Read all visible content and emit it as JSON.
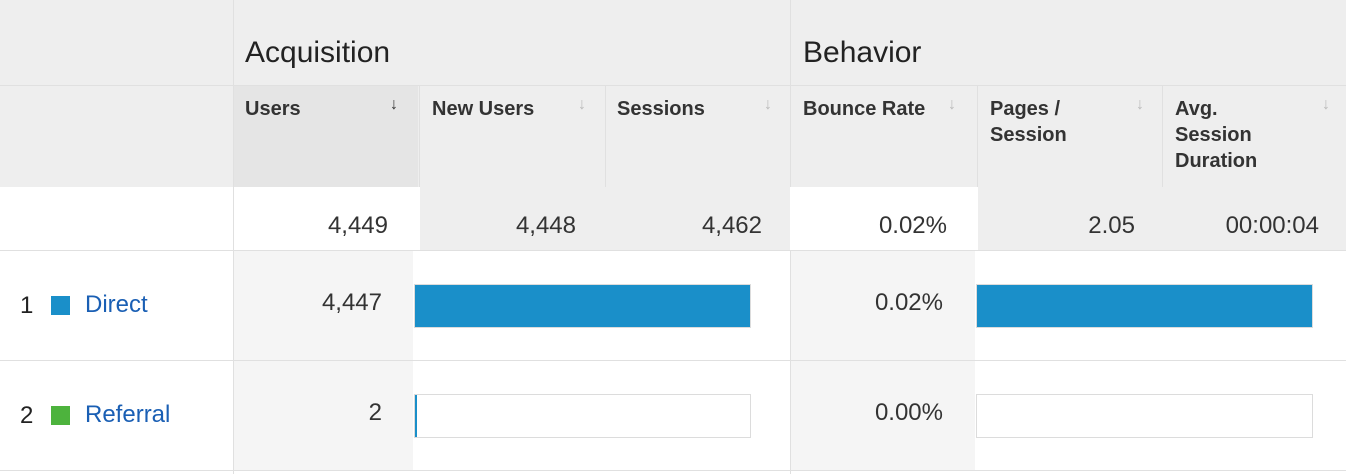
{
  "groups": {
    "acquisition": "Acquisition",
    "behavior": "Behavior"
  },
  "columns": {
    "users": "Users",
    "new_users": "New Users",
    "sessions": "Sessions",
    "bounce_rate": "Bounce Rate",
    "pages_session": "Pages / Session",
    "avg_duration": "Avg. Session Duration"
  },
  "sort_icons": {
    "users": "↓",
    "other": "↓"
  },
  "totals": {
    "users": "4,449",
    "new_users": "4,448",
    "sessions": "4,462",
    "bounce_rate": "0.02%",
    "pages_session": "2.05",
    "avg_duration": "00:00:04"
  },
  "rows": [
    {
      "num": "1",
      "label": "Direct",
      "color": "#1a8fc9",
      "users": "4,447",
      "users_bar_fraction": 1.0,
      "bounce_rate": "0.02%",
      "bounce_bar_fraction": 1.0
    },
    {
      "num": "2",
      "label": "Referral",
      "color": "#4db33d",
      "users": "2",
      "users_bar_fraction": 0.0005,
      "bounce_rate": "0.00%",
      "bounce_bar_fraction": 0.0
    }
  ],
  "colors": {
    "bar": "#1a8fc9",
    "header_bg": "#eeeeee",
    "sorted_bg": "#e5e5e5",
    "link": "#1a5fb4"
  }
}
